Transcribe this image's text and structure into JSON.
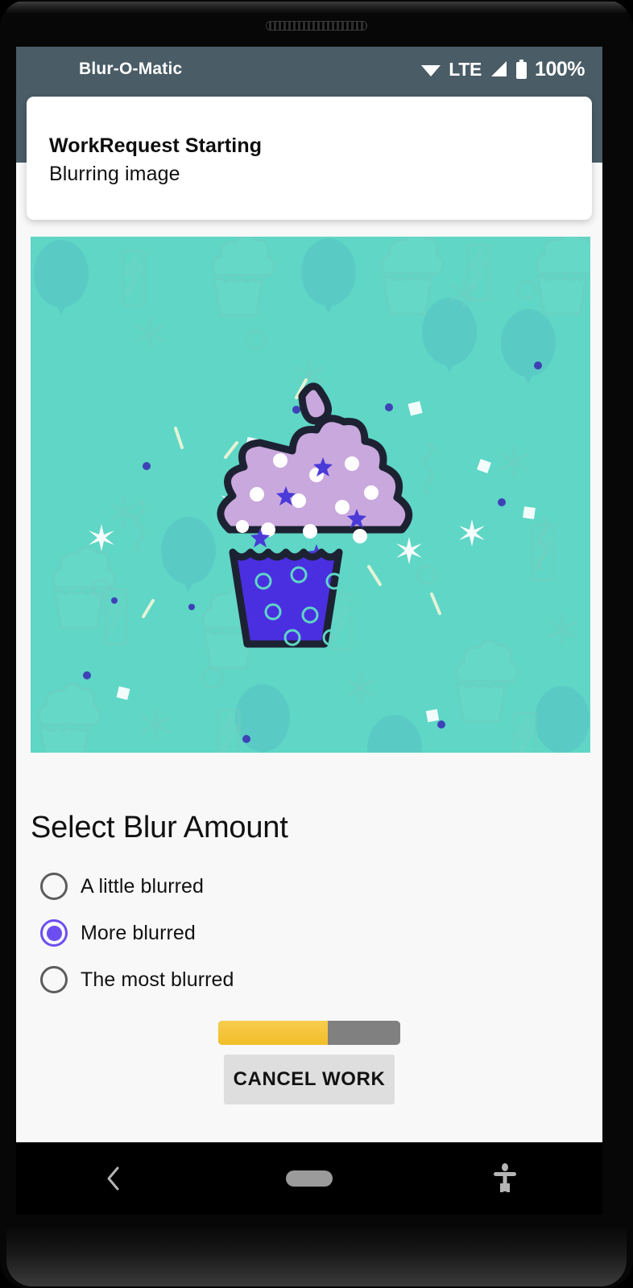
{
  "device": {
    "speaker_icon": "speaker-grille"
  },
  "status_bar": {
    "app_title": "Blur-O-Matic",
    "background_color": "#4a5c66",
    "wifi_icon": "wifi-icon",
    "network_label": "LTE",
    "signal_icon": "signal-icon",
    "battery_icon": "battery-icon",
    "battery_percent": "100%"
  },
  "status_card": {
    "title": "WorkRequest Starting",
    "subtitle": "Blurring image"
  },
  "image": {
    "alt": "cupcake-illustration",
    "background_color": "#5fd6c6",
    "frosting_color": "#c9a8dd",
    "wrapper_color": "#4a2fe0",
    "outline_color": "#1d2233"
  },
  "content": {
    "section_title": "Select Blur Amount",
    "blur_options": [
      {
        "label": "A little blurred",
        "selected": false
      },
      {
        "label": "More blurred",
        "selected": true
      },
      {
        "label": "The most blurred",
        "selected": false
      }
    ],
    "selected_color": "#6c4ef0",
    "progress": {
      "percent": 60,
      "fill_color": "#f2be28",
      "track_color": "#808080"
    },
    "cancel_button_label": "CANCEL WORK"
  },
  "nav_bar": {
    "back_icon": "back-chevron-icon",
    "home_icon": "home-pill-icon",
    "accessibility_icon": "accessibility-icon"
  }
}
